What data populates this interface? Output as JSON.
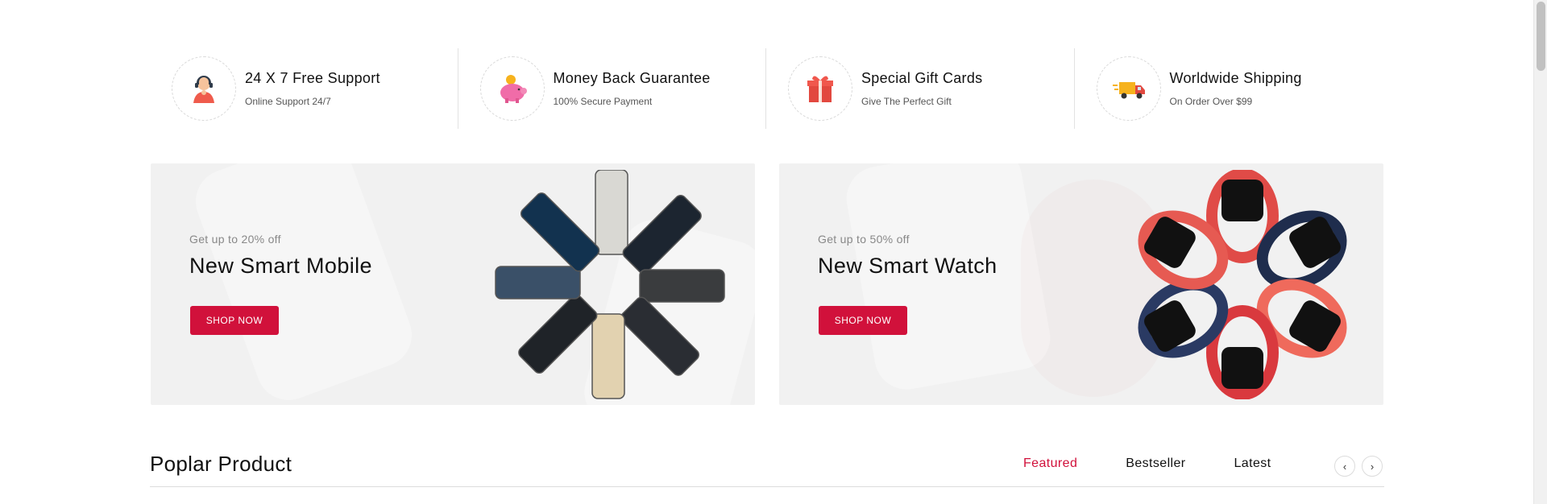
{
  "features": [
    {
      "title": "24 X 7 Free Support",
      "subtitle": "Online Support 24/7",
      "icon": "support-agent-icon"
    },
    {
      "title": "Money Back Guarantee",
      "subtitle": "100% Secure Payment",
      "icon": "piggy-bank-icon"
    },
    {
      "title": "Special Gift Cards",
      "subtitle": "Give The Perfect Gift",
      "icon": "gift-box-icon"
    },
    {
      "title": "Worldwide Shipping",
      "subtitle": "On Order Over $99",
      "icon": "delivery-truck-icon"
    }
  ],
  "banners": [
    {
      "offer": "Get up to 20% off",
      "title": "New Smart Mobile",
      "button": "SHOP NOW",
      "image": "smartphones-image"
    },
    {
      "offer": "Get up to 50% off",
      "title": "New Smart Watch",
      "button": "SHOP NOW",
      "image": "smartwatches-image"
    }
  ],
  "popular": {
    "title": "Poplar Product",
    "tabs": [
      "Featured",
      "Bestseller",
      "Latest"
    ],
    "active_tab": "Featured",
    "prev_icon": "chevron-left-icon",
    "next_icon": "chevron-right-icon"
  },
  "colors": {
    "accent": "#d1113b",
    "banner_bg": "#f1f1f1"
  }
}
